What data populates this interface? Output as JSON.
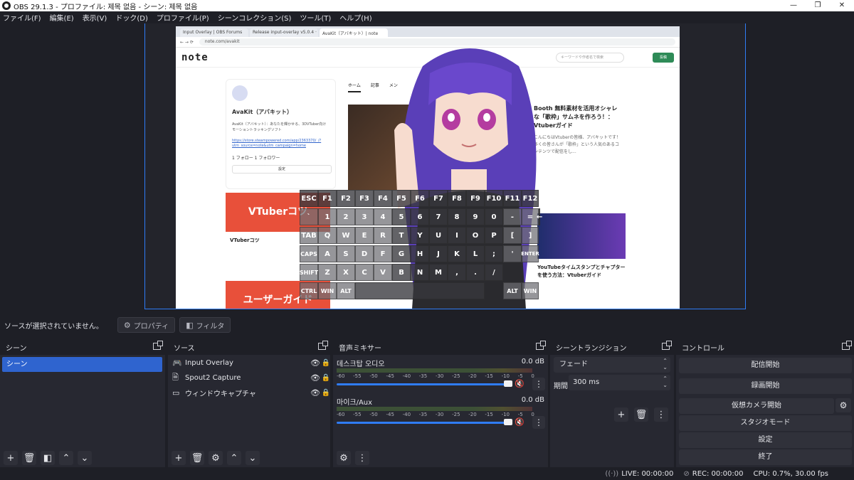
{
  "window": {
    "title": "OBS 29.1.3 - プロファイル: 제목 없음 - シーン: 제목 없음",
    "minimize": "—",
    "maximize": "❐",
    "close": "✕"
  },
  "menu": [
    "ファイル(F)",
    "編集(E)",
    "表示(V)",
    "ドック(D)",
    "プロファイル(P)",
    "シーンコレクション(S)",
    "ツール(T)",
    "ヘルプ(H)"
  ],
  "preview": {
    "browser": {
      "tabs": [
        "Input Overlay | OBS Forums",
        "Release input-overlay v5.0.4 · u",
        "AvaKit（アバキット）| note"
      ],
      "url": "note.com/avakit",
      "logo": "note",
      "search_placeholder": "キーワードや作者名で検索",
      "post_button": "投稿",
      "profile": {
        "name": "AvaKit（アバキット）",
        "desc": "AvaKit（アバキット）：あなたを輝かせる、3DVTuber向けモーショントラッキングソフト",
        "link": "https://store.steampowered.com/app/2363370/_/?utm_source=note&utm_campaign=home",
        "follow": "1 フォロー  1 フォロワー",
        "settings": "設定"
      },
      "tabs_row": [
        "ホーム",
        "記事",
        "メン"
      ],
      "banner1": "VTuberコツ",
      "banner1_label": "VTuberコツ",
      "banner2": "ユーザーガイド",
      "article1_title": "Booth 無料素材を活用オシャレな「歌枠」サムネを作ろう！：Vtuberガイド",
      "article1_desc": "こんにちはVtuberの皆様、アバキットです！ 多くの皆さんが「歌枠」という人気のあるコンテンツで配信をし...",
      "article2_title": "YouTubeタイムスタンプとチャプターを使う方法：Vtuberガイド"
    },
    "keyboard": {
      "row1": [
        "ESC",
        "F1",
        "F2",
        "F3",
        "F4",
        "F5",
        "F6",
        "F7",
        "F8",
        "F9",
        "F10",
        "F11",
        "F12"
      ],
      "row2": [
        "`",
        "1",
        "2",
        "3",
        "4",
        "5",
        "6",
        "7",
        "8",
        "9",
        "0",
        "-",
        "=",
        "←"
      ],
      "row3": [
        "TAB",
        "Q",
        "W",
        "E",
        "R",
        "T",
        "Y",
        "U",
        "I",
        "O",
        "P",
        "[",
        "]"
      ],
      "row4": [
        "CAPS",
        "A",
        "S",
        "D",
        "F",
        "G",
        "H",
        "J",
        "K",
        "L",
        ";",
        "'",
        "ENTER"
      ],
      "row5": [
        "SHIFT",
        "Z",
        "X",
        "C",
        "V",
        "B",
        "N",
        "M",
        ",",
        ".",
        "/"
      ],
      "row6": [
        "CTRL",
        "WIN",
        "ALT",
        "",
        "ALT",
        "WIN",
        "CTRL"
      ]
    }
  },
  "source_toolbar": {
    "no_selection": "ソースが選択されていません。",
    "properties": "プロパティ",
    "filters": "フィルタ"
  },
  "docks": {
    "scenes": {
      "title": "シーン",
      "items": [
        "シーン"
      ]
    },
    "sources": {
      "title": "ソース",
      "items": [
        {
          "name": "Input Overlay",
          "icon": "gamepad-icon"
        },
        {
          "name": "Spout2 Capture",
          "icon": "file-icon"
        },
        {
          "name": "ウィンドウキャプチャ",
          "icon": "window-icon"
        }
      ]
    },
    "mixer": {
      "title": "音声ミキサー",
      "channels": [
        {
          "name": "데스크탑 오디오",
          "db": "0.0 dB",
          "level": 0.91
        },
        {
          "name": "마이크/Aux",
          "db": "0.0 dB",
          "level": 0.91
        }
      ],
      "ticks": [
        "-60",
        "-55",
        "-50",
        "-45",
        "-40",
        "-35",
        "-30",
        "-25",
        "-20",
        "-15",
        "-10",
        "-5",
        "0"
      ]
    },
    "transitions": {
      "title": "シーントランジション",
      "type": "フェード",
      "duration_label": "期間",
      "duration": "300 ms"
    },
    "controls": {
      "title": "コントロール",
      "buttons": [
        "配信開始",
        "録画開始",
        "仮想カメラ開始",
        "スタジオモード",
        "設定",
        "終了"
      ]
    }
  },
  "status": {
    "live": "LIVE: 00:00:00",
    "rec": "REC: 00:00:00",
    "cpu": "CPU: 0.7%, 30.00 fps"
  },
  "colors": {
    "accent": "#2f64cf",
    "preview_border": "#2f7cf6",
    "background": "#1e1f26",
    "dock": "#272831"
  }
}
